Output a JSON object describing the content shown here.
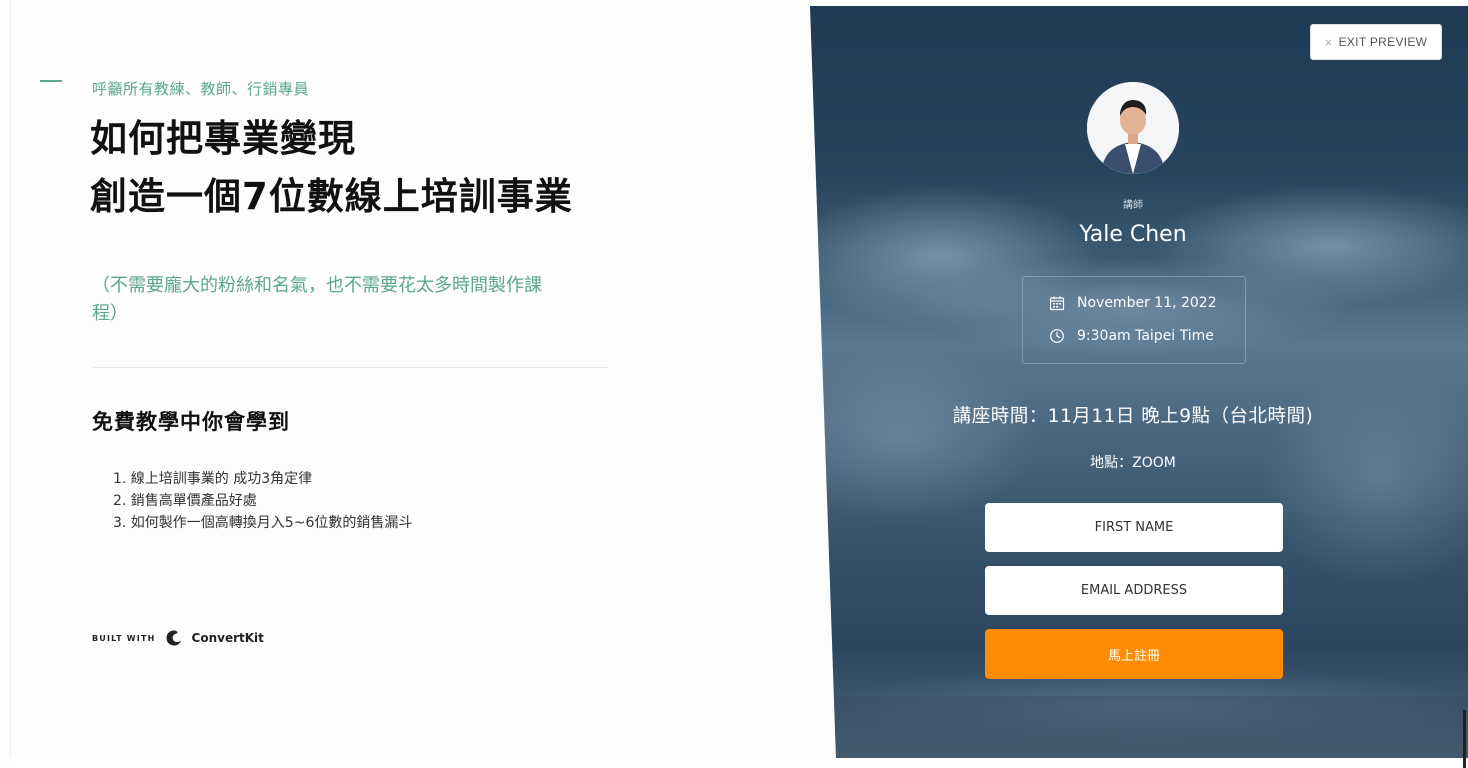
{
  "colors": {
    "accent_green": "#5aa889",
    "cta_orange": "#fd8c04",
    "ocean_dark": "#203b56",
    "ocean_light": "#4d6d85"
  },
  "left": {
    "eyebrow": "呼籲所有教練、教師、行銷專員",
    "headline_line1": "如何把專業變現",
    "headline_line2": "創造一個7位數線上培訓事業",
    "subtitle": "（不需要龐大的粉絲和名氣，也不需要花太多時間製作課程）",
    "learn_heading": "免費教學中你會學到",
    "learn_items": [
      "1. 線上培訓事業的 成功3角定律",
      "2. 銷售高單價產品好處",
      "3. 如何製作一個高轉換月入5~6位數的銷售漏斗"
    ],
    "built_with": "BUILT WITH",
    "brand": "ConvertKit",
    "brand_icon": "convertkit-logo-icon"
  },
  "hero": {
    "exit_preview": "EXIT PREVIEW",
    "exit_icon": "close-icon",
    "role": "講師",
    "speaker": "Yale Chen",
    "date": "November 11, 2022",
    "date_icon": "calendar-icon",
    "time": "9:30am Taipei Time",
    "time_icon": "clock-icon",
    "session_time": "講座時間：11月11日 晚上9點（台北時間)",
    "location": "地點：ZOOM",
    "form": {
      "first_name_placeholder": "FIRST NAME",
      "email_placeholder": "EMAIL ADDRESS",
      "submit_label": "馬上註冊"
    }
  }
}
